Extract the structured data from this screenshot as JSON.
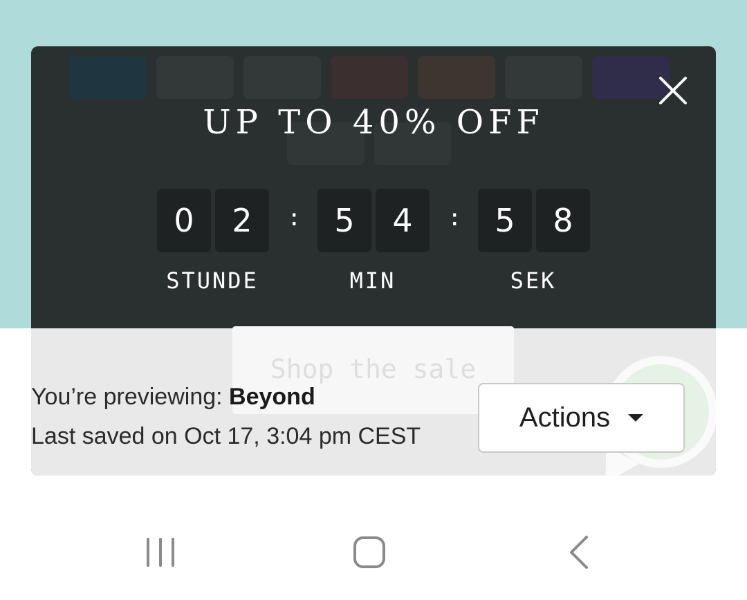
{
  "promo": {
    "headline": "UP TO 40% OFF",
    "close_icon": "close-icon",
    "countdown": {
      "digits": [
        "0",
        "2",
        "5",
        "4",
        "5",
        "8"
      ],
      "separator": ":",
      "units": [
        "STUNDE",
        "MIN",
        "SEK"
      ]
    },
    "cta_label": "Shop the sale"
  },
  "preview_bar": {
    "prefix": "You’re previewing: ",
    "theme_name": "Beyond",
    "saved_text": "Last saved on Oct 17, 3:04 pm CEST",
    "actions_label": "Actions",
    "actions_icon": "caret-down-icon"
  },
  "navbar": {
    "icons": [
      "recent-apps-icon",
      "home-icon",
      "back-icon"
    ]
  },
  "colors": {
    "page_background": "#afdcda",
    "modal_background": "#2a2f2f",
    "digit_tile": "#1e2222"
  }
}
